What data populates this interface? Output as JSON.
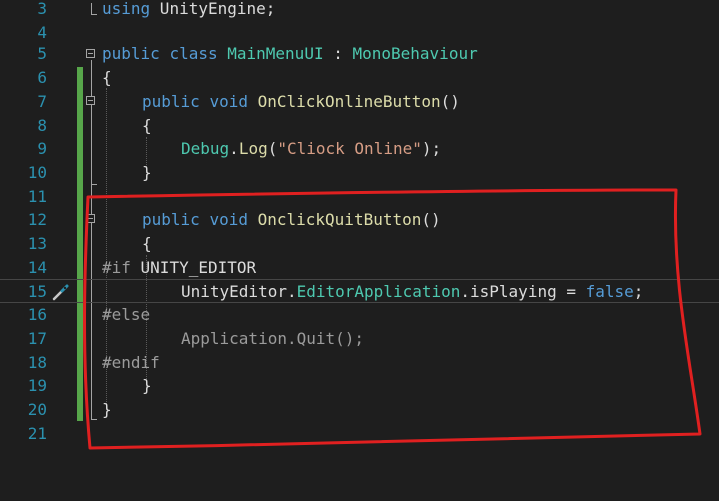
{
  "lines": [
    {
      "number": "3"
    },
    {
      "number": "4"
    },
    {
      "number": "5"
    },
    {
      "number": "6"
    },
    {
      "number": "7"
    },
    {
      "number": "8"
    },
    {
      "number": "9"
    },
    {
      "number": "10"
    },
    {
      "number": "11"
    },
    {
      "number": "12"
    },
    {
      "number": "13"
    },
    {
      "number": "14"
    },
    {
      "number": "15"
    },
    {
      "number": "16"
    },
    {
      "number": "17"
    },
    {
      "number": "18"
    },
    {
      "number": "19"
    },
    {
      "number": "20"
    },
    {
      "number": "21"
    }
  ],
  "code": {
    "l3": {
      "kw": "using",
      "rest": " UnityEngine;"
    },
    "l5": {
      "kw1": "public",
      "kw2": "class",
      "name": "MainMenuUI",
      "sep": " : ",
      "base": "MonoBehaviour"
    },
    "l6": {
      "text": "{"
    },
    "l7": {
      "kw1": "public",
      "kw2": "void",
      "fn": "OnClickOnlineButton",
      "rest": "()"
    },
    "l8": {
      "text": "{"
    },
    "l9": {
      "cls": "Debug",
      "dot": ".",
      "fn": "Log",
      "open": "(",
      "str": "\"Cliock Online\"",
      "close": ");"
    },
    "l10": {
      "text": "}"
    },
    "l12": {
      "kw1": "public",
      "kw2": "void",
      "fn": "OnclickQuitButton",
      "rest": "()"
    },
    "l13": {
      "text": "{"
    },
    "l14": {
      "directive": "#if",
      "symbol": " UNITY_EDITOR"
    },
    "l15": {
      "ns": "UnityEditor",
      "dot1": ".",
      "cls": "EditorApplication",
      "dot2": ".",
      "prop": "isPlaying",
      "eq": " = ",
      "val": "false",
      "end": ";"
    },
    "l16": {
      "directive": "#else"
    },
    "l17": {
      "text": "Application.Quit();"
    },
    "l18": {
      "directive": "#endif"
    },
    "l19": {
      "text": "}"
    },
    "l20": {
      "text": "}"
    }
  },
  "colors": {
    "keyword": "#569cd6",
    "type": "#4ec9b0",
    "method": "#dcdcaa",
    "string": "#d69d85",
    "preprocessor": "#9b9b9b",
    "line_number": "#2b91af",
    "change_bar": "#57a64a",
    "annotation": "#e02020"
  },
  "icons": {
    "quick_action": "screwdriver-icon",
    "fold": "collapse-minus-icon"
  }
}
